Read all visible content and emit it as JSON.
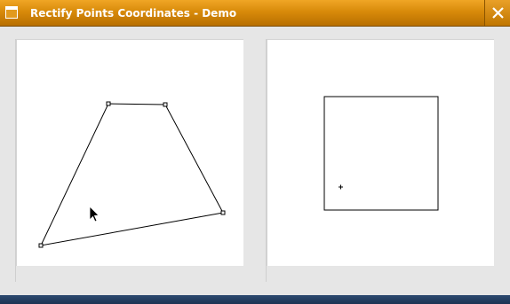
{
  "window": {
    "title": "Rectify Points Coordinates - Demo"
  },
  "titlebar": {
    "app_icon": "window-icon",
    "close_icon": "close-icon"
  },
  "colors": {
    "titlebar": "#d88a0a",
    "canvas": "#ffffff",
    "stroke": "#000000"
  }
}
